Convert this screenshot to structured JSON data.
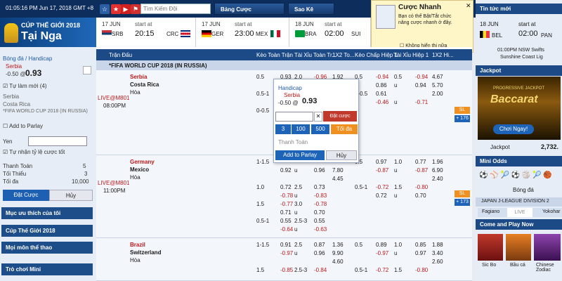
{
  "header": {
    "clock": "01:05:16 PM Jun 17, 2018 GMT +8",
    "search_placeholder": "Tìm Kiếm Đội",
    "tab_live": "Bảng Cược",
    "tab_saved": "Sao Kê"
  },
  "banner": {
    "line1": "CÚP THẾ GIỚI 2018",
    "line2": "Tại Nga"
  },
  "top_matches": [
    {
      "date": "17 JUN",
      "start": "start at",
      "time": "20:15",
      "home": "SRB",
      "away": "CRC"
    },
    {
      "date": "17 JUN",
      "start": "start at",
      "time": "23:00",
      "home": "GER",
      "away": "MEX"
    },
    {
      "date": "18 JUN",
      "start": "start at",
      "time": "02:00",
      "home": "BRA",
      "away": "SUI"
    }
  ],
  "tip": {
    "title": "Cược Nhanh",
    "text": "Bạn có thể Bật/Tắt chức năng cược nhanh ở đây.",
    "checkbox": "Không hiển thị nữa"
  },
  "slip": {
    "type": "Bóng đá / Handicap",
    "pick": "Serbia",
    "line": "-0.50 @",
    "odds": "0.93",
    "auto": "Tự làm mới (4)",
    "team1": "Serbia",
    "team2": "Costa Rica",
    "league": "*FIFA WORLD CUP 2018 (IN RUSSIA)",
    "parlay": "Add to Parlay",
    "yen": "Yen",
    "accept": "Tự nhận tỷ lệ cược tốt",
    "pay_label": "Thanh Toán",
    "pay_val": "5",
    "min_label": "Tối Thiểu",
    "min_val": "3",
    "max_label": "Tối đa",
    "max_val": "10,000",
    "bet_btn": "Đặt Cược",
    "cancel_btn": "Hủy"
  },
  "left_menu": [
    "Mục ưu thích của tôi",
    "Cúp Thế Giới 2018",
    "Mọi môn thể thao",
    "Trò chơi Mini"
  ],
  "grid": {
    "headers": [
      "Trận Đấu",
      "Kèo Toàn Trận",
      "Tài Xỉu Toàn Tr...",
      "1X2 To...",
      "Kèo Chấp Hiệp 1",
      "Tài Xỉu Hiệp 1",
      "1X2 Hi..."
    ],
    "league": "*FIFA WORLD CUP 2018 (IN RUSSIA)",
    "matches": [
      {
        "live": "LIVE@M801",
        "time": "08:00PM",
        "home": "Serbia",
        "away": "Costa Rica",
        "draw": "Hòa",
        "sl": "SL",
        "more": "+ 176",
        "rows": [
          [
            "0.5",
            "0.93",
            "2.0",
            "-0.96",
            "1.92",
            "0.5",
            "-0.94",
            "0.5",
            "-0.94",
            "4.67"
          ],
          [
            "",
            "-0.85",
            "u",
            "0.84",
            "",
            "",
            "0.86",
            "u",
            "0.94",
            "5.70"
          ],
          [
            "0.5-1",
            "",
            "",
            "",
            "",
            "0-0.5",
            "0.61",
            "",
            "",
            "2.00"
          ],
          [
            "",
            "",
            "",
            "",
            "",
            "",
            "-0.46",
            "u",
            "-0.71",
            ""
          ],
          [
            "0-0.5",
            "",
            "",
            "",
            "",
            "",
            "",
            "",
            "",
            ""
          ]
        ]
      },
      {
        "live": "LIVE@M801",
        "time": "11:00PM",
        "home": "Germany",
        "away": "Mexico",
        "draw": "Hòa",
        "sl": "SL",
        "more": "+ 173",
        "rows": [
          [
            "1-1.5",
            "",
            "",
            "",
            "",
            "0.5",
            "0.97",
            "1.0",
            "0.77",
            "1.96"
          ],
          [
            "",
            "0.92",
            "u",
            "0.96",
            "7.80",
            "",
            "-0.87",
            "u",
            "-0.87",
            "6.90"
          ],
          [
            "",
            "",
            "",
            "",
            "4.45",
            "",
            "",
            "",
            "",
            "2.40"
          ],
          [
            "1.0",
            "0.72",
            "2.5",
            "0.73",
            "",
            "0.5-1",
            "-0.72",
            "1.5",
            "-0.80",
            ""
          ],
          [
            "",
            "-0.78",
            "u",
            "-0.83",
            "",
            "",
            "0.72",
            "u",
            "0.70",
            ""
          ],
          [
            "1.5",
            "-0.77",
            "3.0",
            "-0.78",
            "",
            "",
            "",
            "",
            "",
            ""
          ],
          [
            "",
            "0.71",
            "u",
            "0.70",
            "",
            "",
            "",
            "",
            "",
            ""
          ],
          [
            "0.5-1",
            "0.55",
            "2.5-3",
            "0.55",
            "",
            "",
            "",
            "",
            "",
            ""
          ],
          [
            "",
            "-0.64",
            "u",
            "-0.63",
            "",
            "",
            "",
            "",
            "",
            ""
          ]
        ]
      },
      {
        "live": "",
        "time": "",
        "home": "Brazil",
        "away": "Switzerland",
        "draw": "Hòa",
        "sl": "",
        "more": "",
        "rows": [
          [
            "1-1.5",
            "0.91",
            "2.5",
            "0.87",
            "1.36",
            "0.5",
            "0.89",
            "1.0",
            "0.85",
            "1.88"
          ],
          [
            "",
            "-0.97",
            "u",
            "0.96",
            "9.90",
            "",
            "-0.97",
            "u",
            "0.97",
            "3.40"
          ],
          [
            "",
            "",
            "",
            "",
            "4.60",
            "",
            "",
            "",
            "",
            "2.60"
          ],
          [
            "1.5",
            "-0.85",
            "2.5-3",
            "-0.84",
            "",
            "0.5-1",
            "-0.72",
            "1.5",
            "-0.80",
            ""
          ]
        ]
      }
    ]
  },
  "popup": {
    "type": "Handicap",
    "pick": "Serbia",
    "line": "-0.50 @",
    "odds": "0.93",
    "bet": "Đặt cược",
    "chips": [
      "3",
      "100",
      "500",
      "Tối đa"
    ],
    "pay": "Thanh Toán",
    "add": "Add to Parlay",
    "cancel": "Hủy"
  },
  "right": {
    "news": "Tin tức mới",
    "news_date": "18 JUN",
    "news_start": "start at",
    "news_time": "02:00",
    "news_home": "BEL",
    "news_away": "PAN",
    "news2": "01:00PM NSW Swifts",
    "news3": "Sunshine Coast Lig",
    "jackpot": "Jackpot",
    "jp_title": "Baccarat",
    "jp_sub": "PROGRESSIVE JACKPOT",
    "jp_btn": "Chơi Ngay!",
    "jp_label": "Jackpot",
    "jp_val": "2,732.",
    "mini": "Mini Odds",
    "mini_sport": "Bóng đá",
    "league": "JAPAN J-LEAGUE DIVISION 2",
    "team1": "Fagiano",
    "live": "LIVE",
    "team2": "Yokohar",
    "come": "Come and Play Now",
    "g1": "Sic Bo",
    "g2": "Bầu cá",
    "g3": "Chinese Zodiac"
  }
}
